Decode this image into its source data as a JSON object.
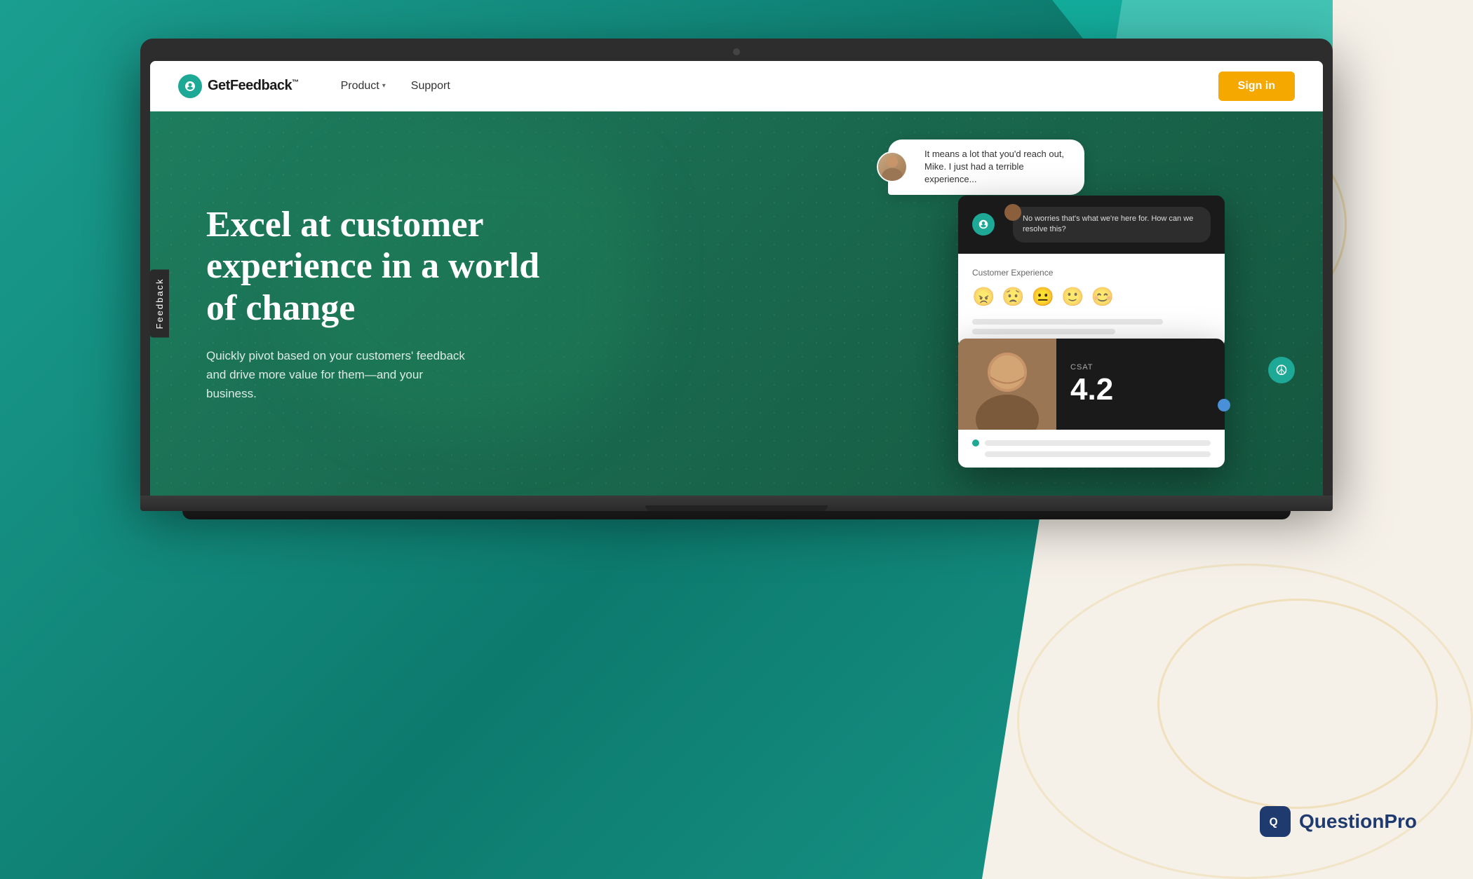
{
  "background": {
    "teal_color": "#1a9e8f",
    "cream_color": "#f5f0e8"
  },
  "navbar": {
    "logo_text": "GetFeedback",
    "logo_tm": "™",
    "nav_items": [
      {
        "label": "Product",
        "has_dropdown": true
      },
      {
        "label": "Support",
        "has_dropdown": false
      }
    ],
    "signin_label": "Sign in"
  },
  "hero": {
    "title": "Excel at customer experience in a world of change",
    "subtitle": "Quickly pivot based on your customers' feedback and drive more value for them—and your business.",
    "feedback_tab": "Feedback"
  },
  "chat": {
    "message": "It means a lot that you'd reach out, Mike. I just had a terrible experience..."
  },
  "agent_chat": {
    "message": "No worries that's what we're here for. How can we resolve this?"
  },
  "survey_card": {
    "label": "Customer Experience",
    "emojis": [
      "😠",
      "😟",
      "😐",
      "🙂",
      "😊"
    ]
  },
  "csat_card": {
    "label": "CSAT",
    "score": "4.2"
  },
  "questionpro": {
    "brand": "QuestionPro",
    "icon_letter": "Q"
  }
}
